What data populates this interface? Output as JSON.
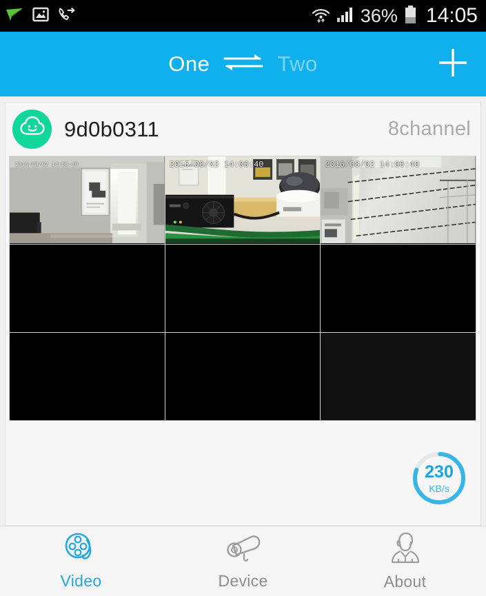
{
  "statusbar": {
    "icons_left": [
      "paper-plane-icon",
      "gallery-image-icon",
      "call-forward-icon"
    ],
    "wifi_icon": "wifi-icon",
    "signal_icon": "cellular-signal-icon",
    "battery_percent": "36%",
    "battery_icon": "battery-icon",
    "clock": "14:05"
  },
  "header": {
    "tab_one": "One",
    "swap_icon": "swap-arrows-icon",
    "tab_two": "Two",
    "add_icon": "plus-icon",
    "accent": "#0fb0ec"
  },
  "device": {
    "avatar_icon": "cloud-smiley-icon",
    "avatar_color": "#12d79a",
    "name": "9d0b0311",
    "channels": "8channel"
  },
  "grid": {
    "columns": 3,
    "rows": 3,
    "cells": [
      {
        "index": 1,
        "active": true,
        "timestamp": "2016/08/02 14:06:40",
        "scene": "office-room-window"
      },
      {
        "index": 2,
        "active": true,
        "timestamp": "2016/08/02 14:06:40",
        "scene": "desk-dvr-dome-camera"
      },
      {
        "index": 3,
        "active": true,
        "timestamp": "2016/08/02 14:06:40",
        "scene": "corridor-ceiling-cables"
      },
      {
        "index": 4,
        "active": false,
        "timestamp": "",
        "scene": "empty"
      },
      {
        "index": 5,
        "active": false,
        "timestamp": "",
        "scene": "empty"
      },
      {
        "index": 6,
        "active": false,
        "timestamp": "",
        "scene": "empty"
      },
      {
        "index": 7,
        "active": false,
        "timestamp": "",
        "scene": "empty"
      },
      {
        "index": 8,
        "active": false,
        "timestamp": "",
        "scene": "empty"
      },
      {
        "index": 9,
        "active": false,
        "timestamp": "",
        "scene": "empty-dim"
      }
    ]
  },
  "bandwidth": {
    "value": "230",
    "unit": "KB/s",
    "ring_color": "#38b6e8",
    "ring_track": "#e4e8ea",
    "fill_percent": 80
  },
  "tabs": [
    {
      "label": "Video",
      "icon": "film-reel-icon",
      "active": true
    },
    {
      "label": "Device",
      "icon": "cctv-camera-icon",
      "active": false
    },
    {
      "label": "About",
      "icon": "person-bust-icon",
      "active": false
    }
  ]
}
